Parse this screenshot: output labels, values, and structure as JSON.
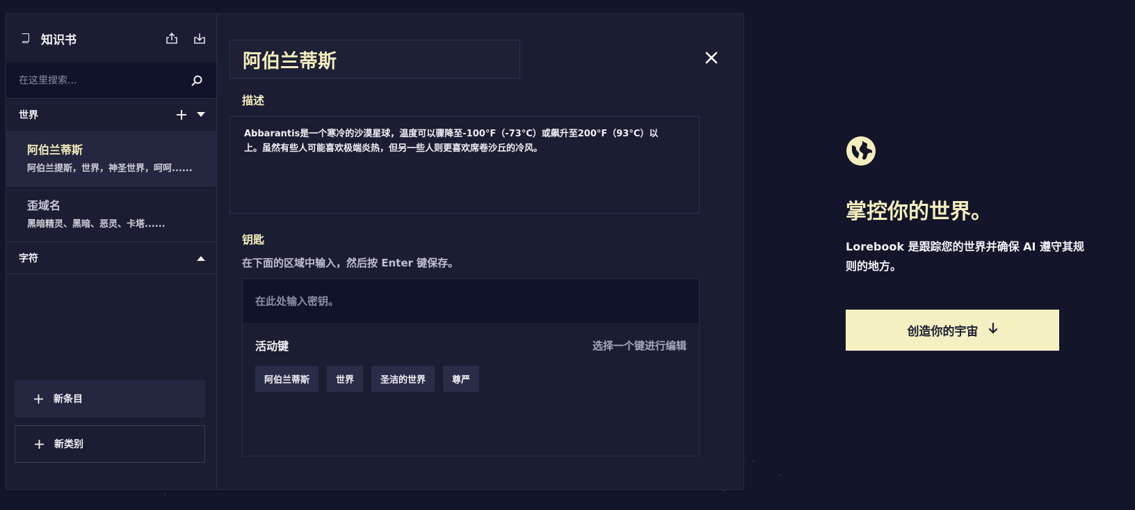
{
  "sidebar": {
    "title": "知识书",
    "search_placeholder": "在这里搜索...",
    "categories": [
      {
        "label": "世界"
      },
      {
        "label": "字符"
      }
    ],
    "entries": [
      {
        "title": "阿伯兰蒂斯",
        "subtitle": "阿伯兰提斯，世界，神圣世界，呵呵......"
      },
      {
        "title": "歪域名",
        "subtitle": "黑暗精灵、黑暗、恶灵、卡塔......"
      }
    ],
    "new_entry_label": "新条目",
    "new_category_label": "新类别"
  },
  "editor": {
    "title": "阿伯兰蒂斯",
    "description_label": "描述",
    "description": "Abbarantis是一个寒冷的沙漠星球，温度可以骤降至-100°F（-73°C）或飙升至200°F（93°C）以上。虽然有些人可能喜欢极端炎热，但另一些人则更喜欢席卷沙丘的冷风。",
    "keys_label": "钥匙",
    "keys_hint": "在下面的区域中输入，然后按 Enter 键保存。",
    "key_placeholder": "在此处输入密钥。",
    "active_keys_label": "活动键",
    "active_keys_hint": "选择一个键进行编辑",
    "keys": [
      "阿伯兰蒂斯",
      "世界",
      "圣洁的世界",
      "尊严"
    ]
  },
  "promo": {
    "title": "掌控你的世界。",
    "description": "Lorebook 是跟踪您的世界并确保 AI 遵守其规则的地方。",
    "cta_label": "创造你的宇宙"
  },
  "colors": {
    "background": "#13152a",
    "panel": "#1b1d32",
    "accent": "#f4eebc",
    "cta_bg": "#f4f0c2"
  }
}
